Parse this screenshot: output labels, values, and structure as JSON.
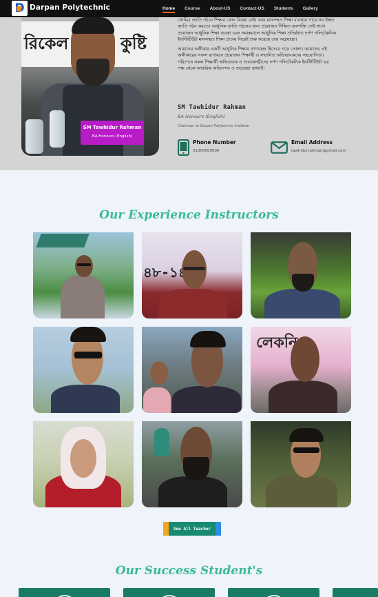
{
  "nav": {
    "brand": "Darpan Polytechnic",
    "items": [
      {
        "label": "Home",
        "active": true
      },
      {
        "label": "Course",
        "active": false
      },
      {
        "label": "About-US",
        "active": false
      },
      {
        "label": "Contact-US",
        "active": false
      },
      {
        "label": "Students",
        "active": false
      },
      {
        "label": "Gallery",
        "active": false
      }
    ]
  },
  "hero": {
    "photo_caption_name": "SM Tawhidur Rahman",
    "photo_caption_degree": "BA Honours (English)",
    "banner_left": "রিকেল",
    "banner_right": "কুষ্টি",
    "bio_p1": "সোমিত্র জাতি গঠনে শিক্ষার কোন বিকল্প নেই। আর মানসম্মত শিক্ষা ব্যবস্থায় পারে সব উন্নত জাতি গঠন করতে। আধুনিক জাতি গঠনের জন্য প্রয়োজন শিক্ষিত জনশক্তি সেই সাথে প্রয়োজন আধুনিক শিক্ষা ব্যবস্থা এবং সমান্তরালে আধুনিক শিক্ষা প্রতিষ্ঠান। দর্পণ পলিটেকনিক ইনস্টিটিউট মানসম্মত শিক্ষা প্রত্যয় নিয়েই শুরু করেছে তার অগ্রযাত্রা।",
    "bio_p2": "আমাদের অঙ্গীকার একটি আধুনিক শিক্ষার প্রাণকেন্দ্র হিসেবে গড়ে তোলা। আমাদের এই অঙ্গীকারের সফল রূপায়নে প্রয়োজন শিক্ষার্থী ও সম্মানিত অভিভাবকদের সহযোগিতা। পরিশেষে সকল শিক্ষার্থী অভিভাবক ও শুভাকাঙ্খীদের দর্পণ পলিটেকনিক ইনস্টিটিউট এর পক্ষ থেকে আন্তরিক অভিনন্দন ও শুভেচ্ছা জানাই।",
    "signature": "SM Tawhidur Rahman",
    "degree": "BA Honours (English)",
    "role": "Chairman at Darpan Polytechnic Institute",
    "phone_label": "Phone Number",
    "phone_value": "01300000000",
    "email_label": "Email Address",
    "email_value": "tawhidurrahman@gmail.com"
  },
  "instructors": {
    "title": "Our Experience Instructors",
    "cards": [
      {
        "name": "instructor-1",
        "photo": "man-in-garden"
      },
      {
        "name": "instructor-2",
        "photo": "man-with-glasses-banner"
      },
      {
        "name": "instructor-3",
        "photo": "man-in-suit-greenery"
      },
      {
        "name": "instructor-4",
        "photo": "man-with-sunglasses"
      },
      {
        "name": "instructor-5",
        "photo": "young-man-street"
      },
      {
        "name": "instructor-6",
        "photo": "man-pink-banner"
      },
      {
        "name": "instructor-7",
        "photo": "woman-in-hijab"
      },
      {
        "name": "instructor-8",
        "photo": "bearded-man-park"
      },
      {
        "name": "instructor-9",
        "photo": "man-with-sunglasses-outdoor"
      }
    ],
    "button_label": "See All Teacher"
  },
  "students": {
    "title": "Our Success Student's"
  },
  "colors": {
    "accent": "#3ab89a",
    "nav_bg": "#111111",
    "hero_bg": "#d4d4d4",
    "button": "#198a72",
    "tag": "#b81cc7"
  }
}
